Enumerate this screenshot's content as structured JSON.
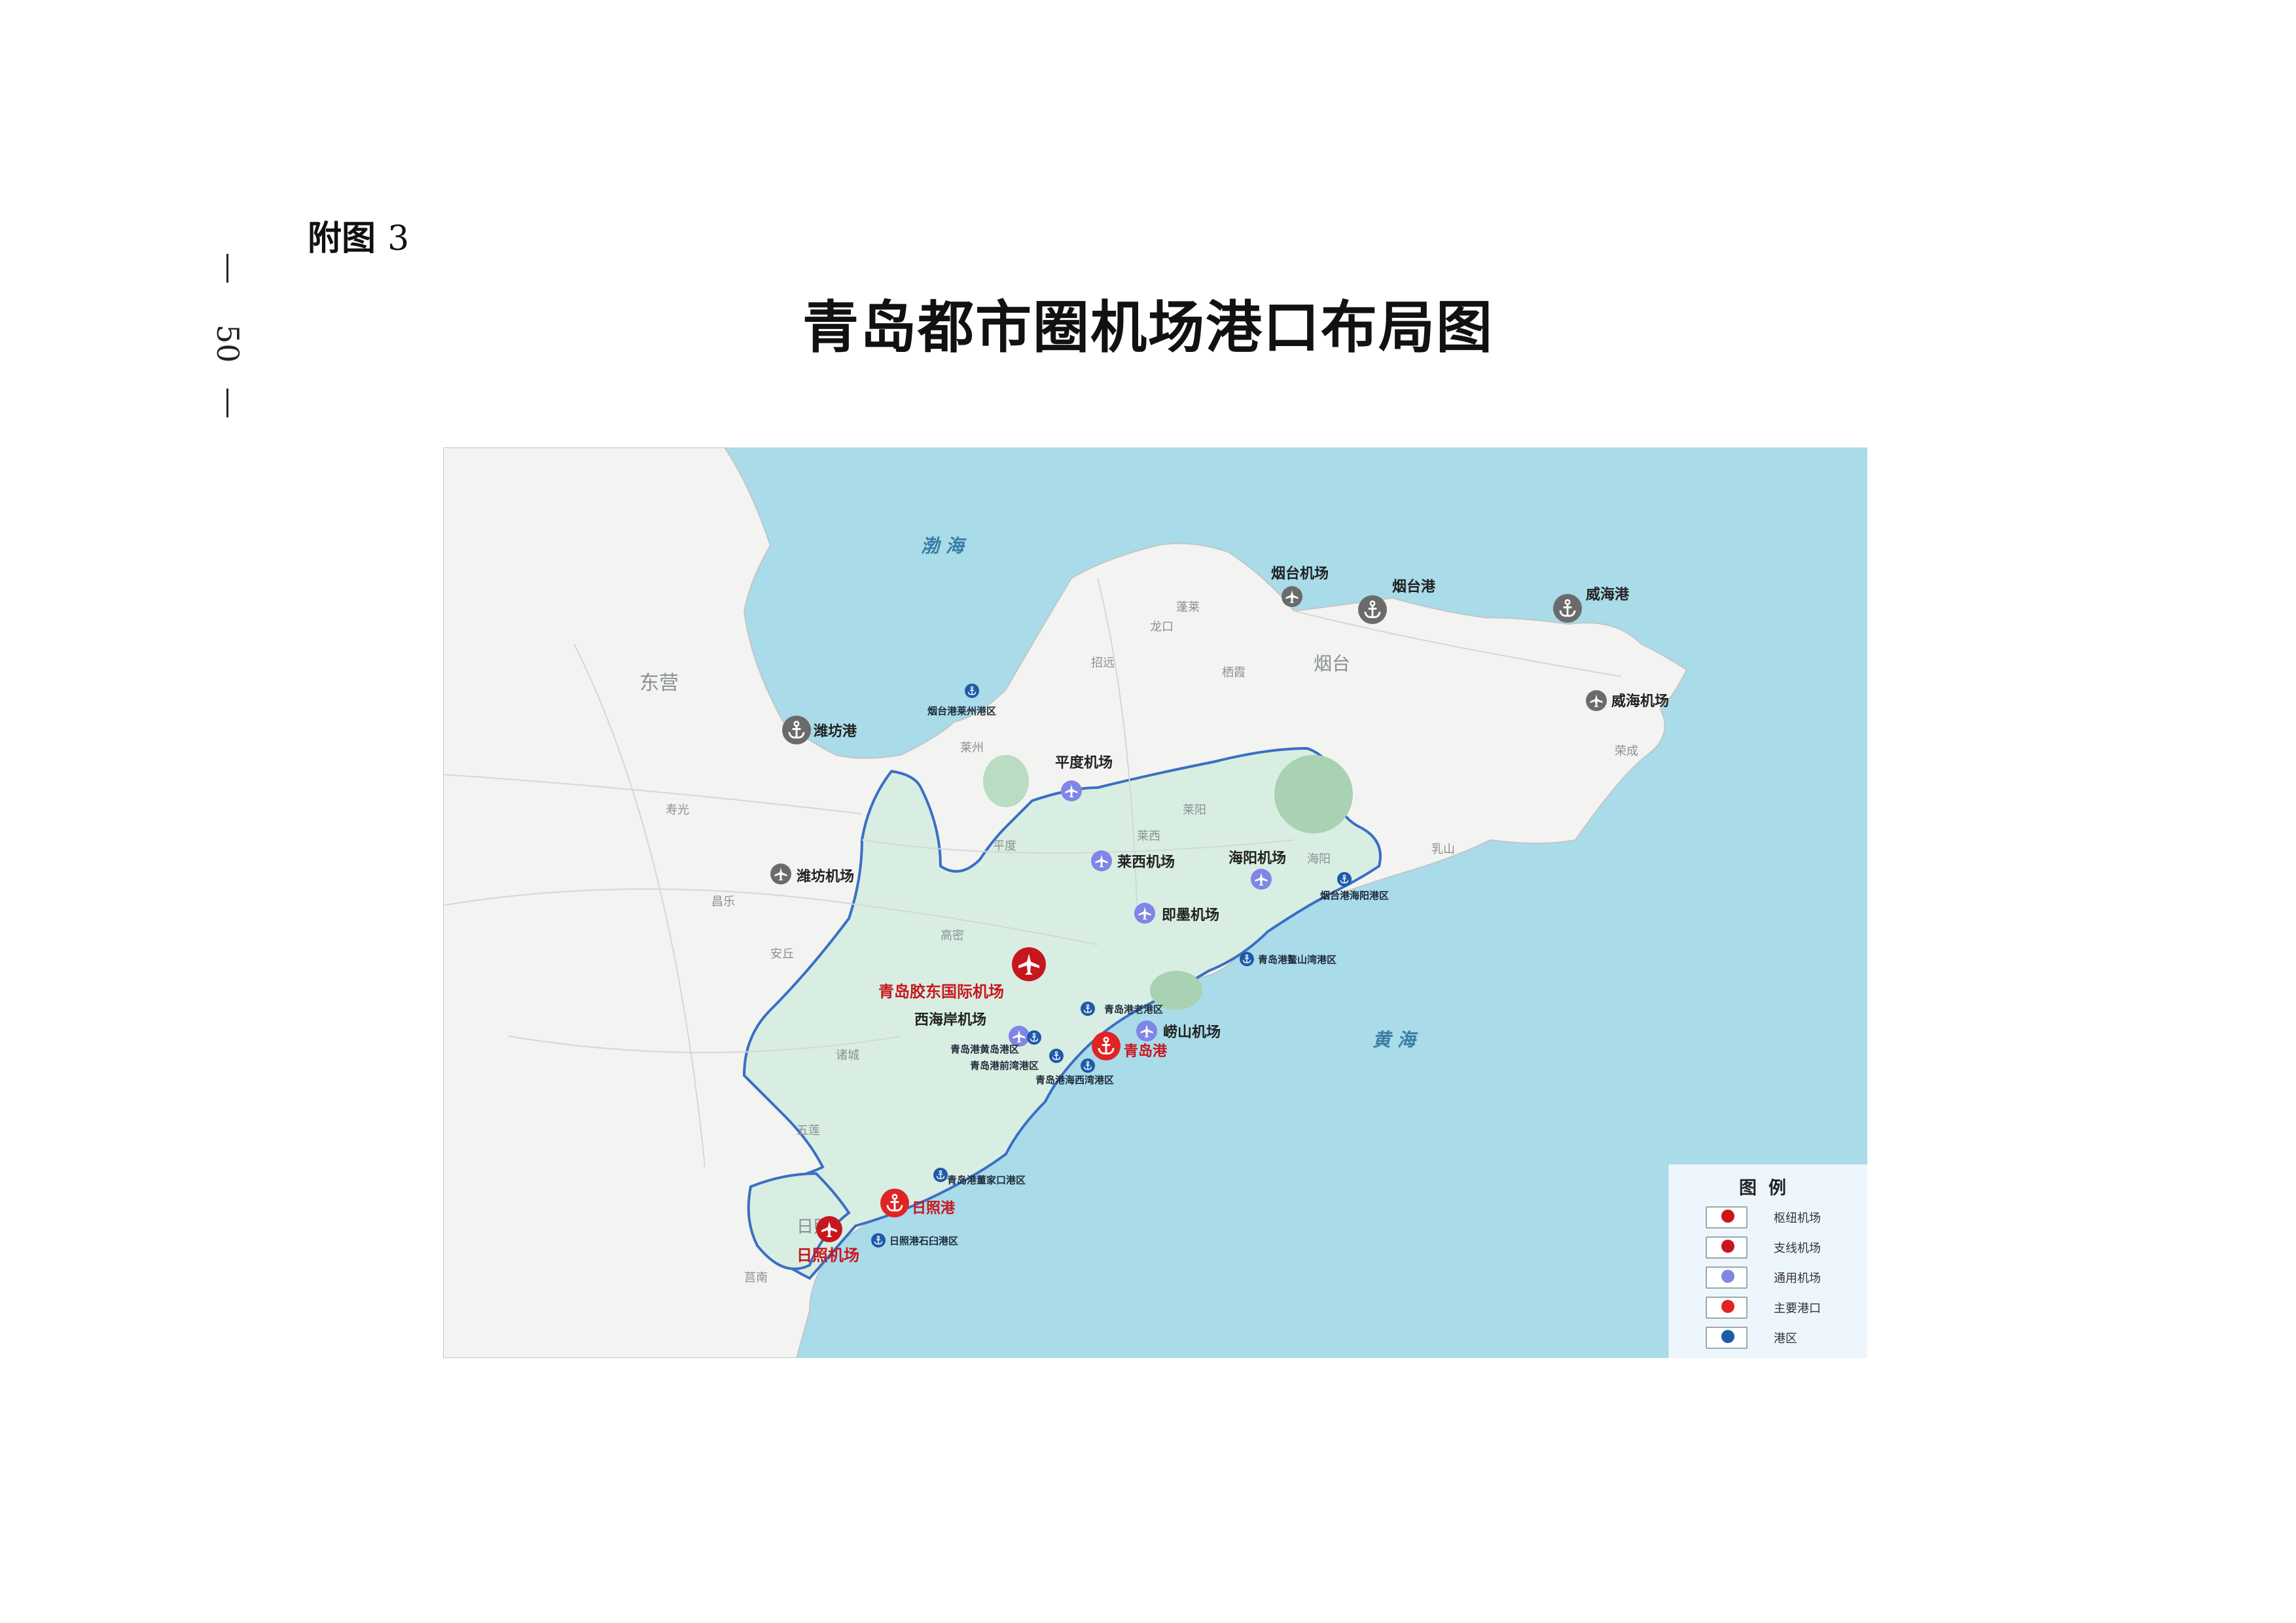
{
  "page": {
    "number": "50",
    "appendix_label": "附图",
    "appendix_number": "3",
    "title": "青岛都市圈机场港口布局图"
  },
  "map": {
    "sea_labels": [
      "渤 海",
      "黄 海"
    ],
    "city_labels": [
      "东营",
      "烟台",
      "日照",
      "龙口",
      "招远",
      "栖霞",
      "蓬莱",
      "乳山",
      "荣成",
      "莱阳",
      "莱西",
      "平度",
      "莱州",
      "寿光",
      "昌乐",
      "安丘",
      "诸城",
      "五莲",
      "莒南",
      "海阳",
      "高密"
    ],
    "facilities": {
      "hub_airport": "青岛胶东国际机场",
      "branch_airport": "日照机场",
      "general_airports": [
        "平度机场",
        "莱西机场",
        "海阳机场",
        "即墨机场",
        "西海岸机场",
        "崂山机场"
      ],
      "main_ports": [
        "青岛港",
        "日照港"
      ],
      "port_areas": [
        "烟台港莱州港区",
        "烟台港海阳港区",
        "青岛港鳌山湾港区",
        "青岛港老港区",
        "青岛港黄岛港区",
        "青岛港前湾港区",
        "青岛港海西湾港区",
        "青岛港董家口港区",
        "日照港石臼港区"
      ],
      "other_airports": [
        "烟台机场",
        "威海机场",
        "潍坊机场"
      ],
      "other_ports": [
        "烟台港",
        "威海港",
        "潍坊港"
      ]
    },
    "colors": {
      "sea": "#a9dbe9",
      "land": "#f3f4f2",
      "metro_area": "#d9eee2",
      "border": "#3b6fc4",
      "hub": "#c8161e",
      "general": "#7f86e6",
      "port_area": "#1d5aa8",
      "other": "#6b6b6b"
    }
  },
  "legend": {
    "title": "图例",
    "items": [
      {
        "label": "枢纽机场",
        "icon": "airplane-icon",
        "color": "#c8161e"
      },
      {
        "label": "支线机场",
        "icon": "airplane-icon",
        "color": "#c8161e"
      },
      {
        "label": "通用机场",
        "icon": "airplane-icon",
        "color": "#7f86e6"
      },
      {
        "label": "主要港口",
        "icon": "anchor-icon",
        "color": "#e02424"
      },
      {
        "label": "港区",
        "icon": "anchor-icon",
        "color": "#1d5aa8"
      }
    ]
  }
}
